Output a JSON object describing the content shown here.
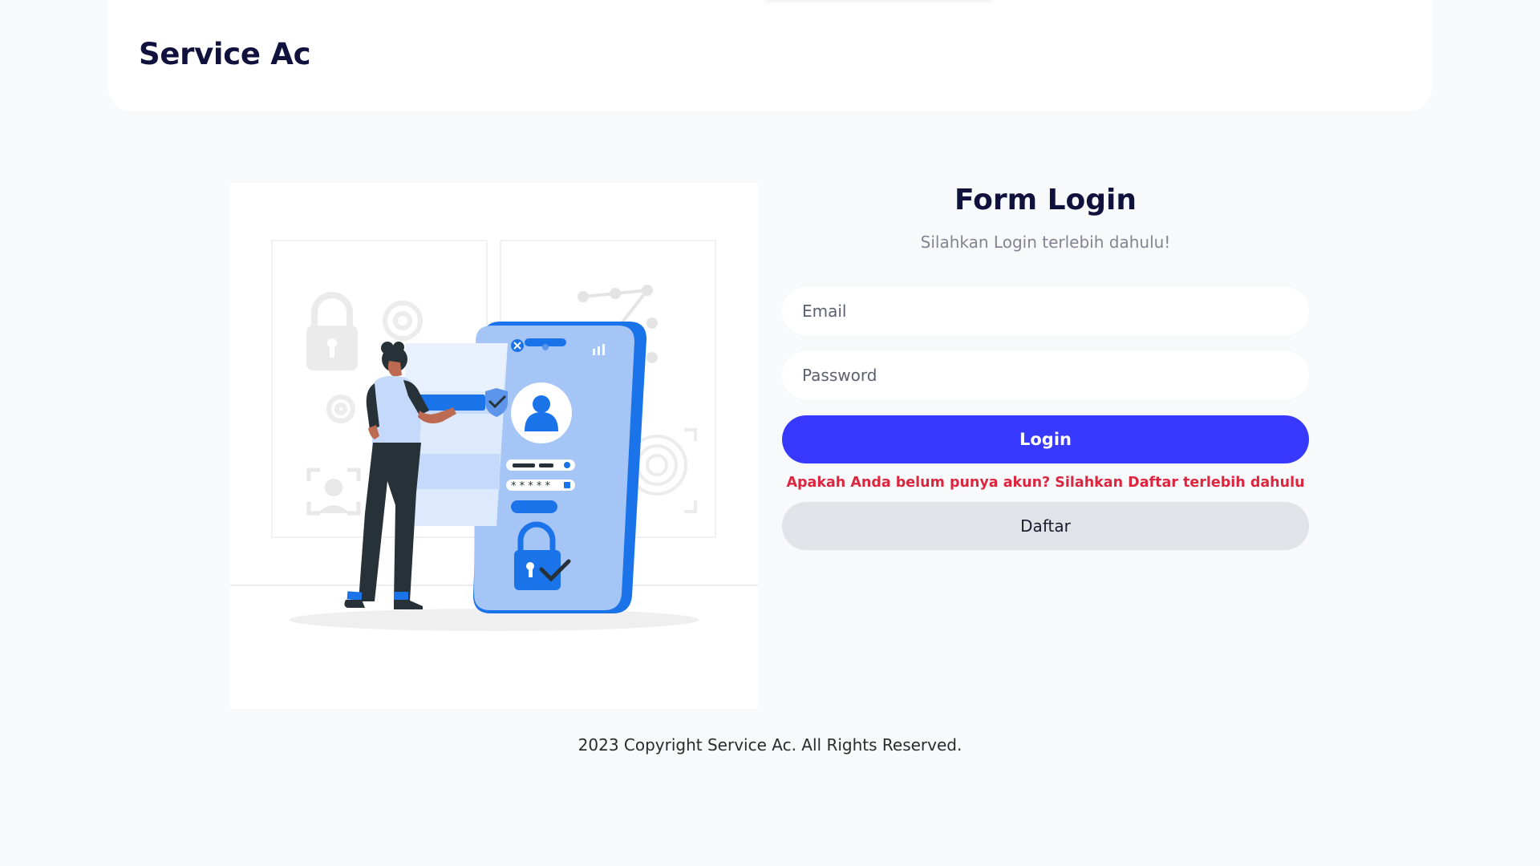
{
  "header": {
    "brand": "Service Ac"
  },
  "illustration": {
    "name": "secure-login-illustration"
  },
  "form": {
    "title": "Form Login",
    "subtitle": "Silahkan Login terlebih dahulu!",
    "email_placeholder": "Email",
    "email_value": "",
    "password_placeholder": "Password",
    "password_value": "",
    "login_label": "Login",
    "register_note": "Apakah Anda belum punya akun? Silahkan Daftar terlebih dahulu",
    "register_label": "Daftar"
  },
  "footer": {
    "copyright": "2023 Copyright Service Ac. All Rights Reserved."
  },
  "colors": {
    "background": "#f8f9fb",
    "brand_text": "#10123d",
    "primary_button": "#3739ff",
    "secondary_button": "#e0e3e7",
    "warning_text": "#dc2640",
    "illustration_blue": "#1a73e8"
  }
}
